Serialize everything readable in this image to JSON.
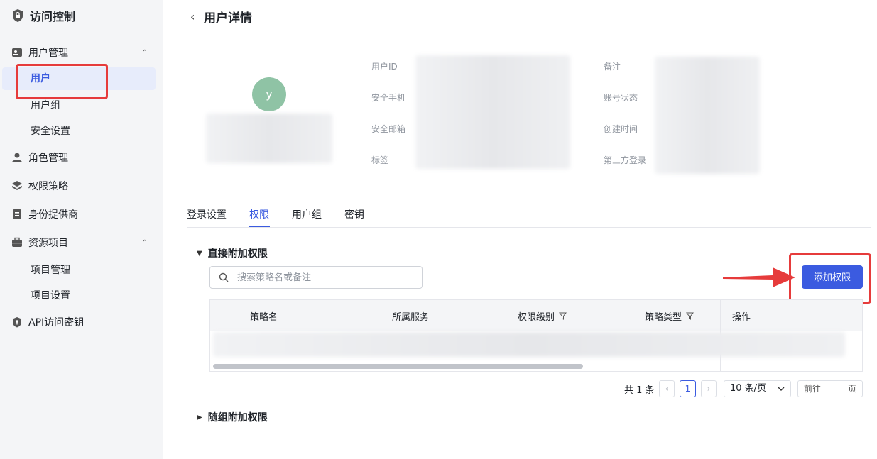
{
  "sidebar": {
    "app_title": "访问控制",
    "groups": [
      {
        "label": "用户管理",
        "caret": "⌃"
      },
      {
        "label": "角色管理"
      },
      {
        "label": "权限策略"
      },
      {
        "label": "身份提供商"
      },
      {
        "label": "资源项目",
        "caret": "⌃"
      },
      {
        "label": "API访问密钥"
      }
    ],
    "user_sub": [
      "用户",
      "用户组",
      "安全设置"
    ],
    "project_sub": [
      "项目管理",
      "项目设置"
    ]
  },
  "header": {
    "back_icon": "‹",
    "title": "用户详情"
  },
  "profile": {
    "avatar_letter": "y",
    "labels_left": [
      "用户ID",
      "安全手机",
      "安全邮箱",
      "标签"
    ],
    "labels_right": [
      "备注",
      "账号状态",
      "创建时间",
      "第三方登录"
    ]
  },
  "tabs": [
    "登录设置",
    "权限",
    "用户组",
    "密钥"
  ],
  "direct_section": {
    "title": "直接附加权限",
    "search_placeholder": "搜索策略名或备注",
    "add_button": "添加权限",
    "columns": [
      "策略名",
      "所属服务",
      "权限级别",
      "策略类型",
      "操作"
    ]
  },
  "pagination": {
    "total": "共 1 条",
    "prev": "‹",
    "current": "1",
    "next": "›",
    "page_size": "10 条/页",
    "jump_prefix": "前往",
    "jump_suffix": "页"
  },
  "group_section": {
    "title": "随组附加权限"
  },
  "colors": {
    "accent": "#3b5be0",
    "highlight": "#e63b3b"
  }
}
